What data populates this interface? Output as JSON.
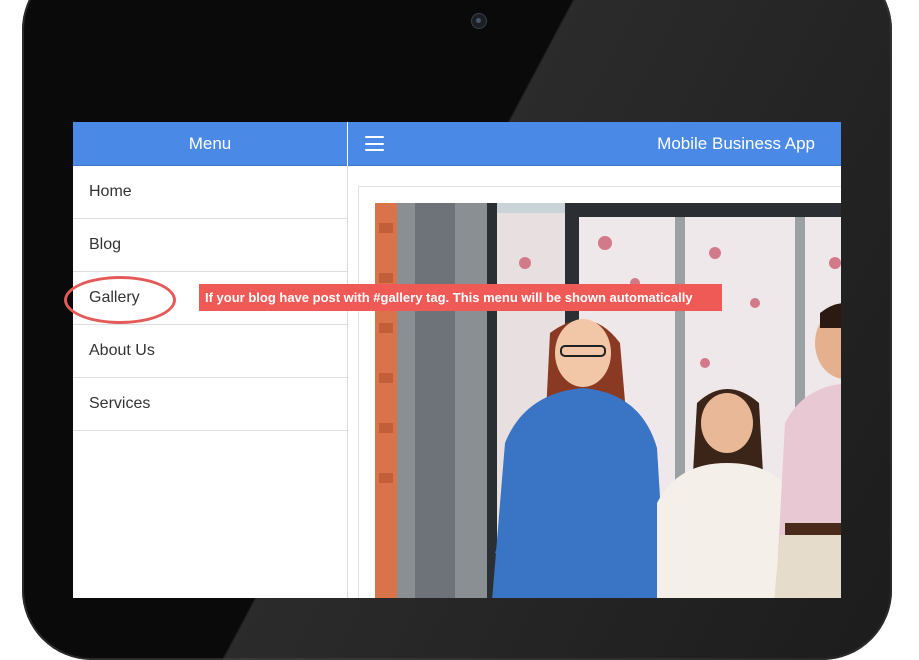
{
  "sidebar": {
    "header": "Menu",
    "items": [
      {
        "label": "Home"
      },
      {
        "label": "Blog"
      },
      {
        "label": "Gallery"
      },
      {
        "label": "About Us"
      },
      {
        "label": "Services"
      }
    ]
  },
  "header": {
    "title": "Mobile Business App",
    "menu_icon": "hamburger-icon"
  },
  "annotation": {
    "text": "If your blog have post with #gallery tag. This menu will be shown automatically",
    "highlight_color": "#ef5a57"
  },
  "colors": {
    "header_bg": "#4a8ae6",
    "device": "#0a0a0a"
  }
}
